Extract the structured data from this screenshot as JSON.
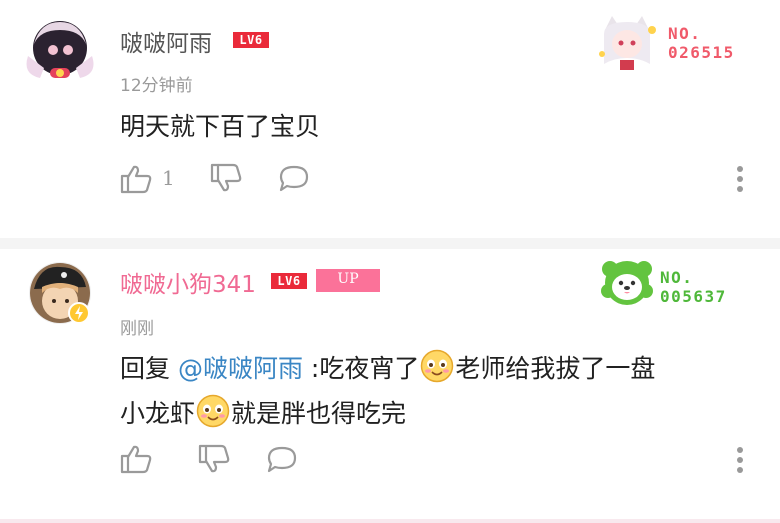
{
  "comments": [
    {
      "username": "啵啵阿雨",
      "level": "LV6",
      "time": "12分钟前",
      "text": "明天就下百了宝贝",
      "like_count": "1",
      "badge_number_label": "NO.",
      "badge_number": "026515",
      "badge_color": "#f05a6a",
      "username_color": "#555555"
    },
    {
      "username": "啵啵小狗341",
      "level": "LV6",
      "up_tag": "UP",
      "time": "刚刚",
      "reply_prefix": "回复 ",
      "mention": "@啵啵阿雨",
      "reply_text_1": " :吃夜宵了",
      "reply_text_2": "老师给我拔了一盘",
      "reply_text_3": "小龙虾",
      "reply_text_4": "就是胖也得吃完",
      "badge_number_label": "NO.",
      "badge_number": "005637",
      "badge_color": "#5cc13e",
      "username_color": "#f06a93"
    }
  ],
  "colors": {
    "lv_badge": "#ea2a3a",
    "up_tag": "#fb7299",
    "mention": "#3a86c4",
    "icon_gray": "#9a9a9a"
  }
}
